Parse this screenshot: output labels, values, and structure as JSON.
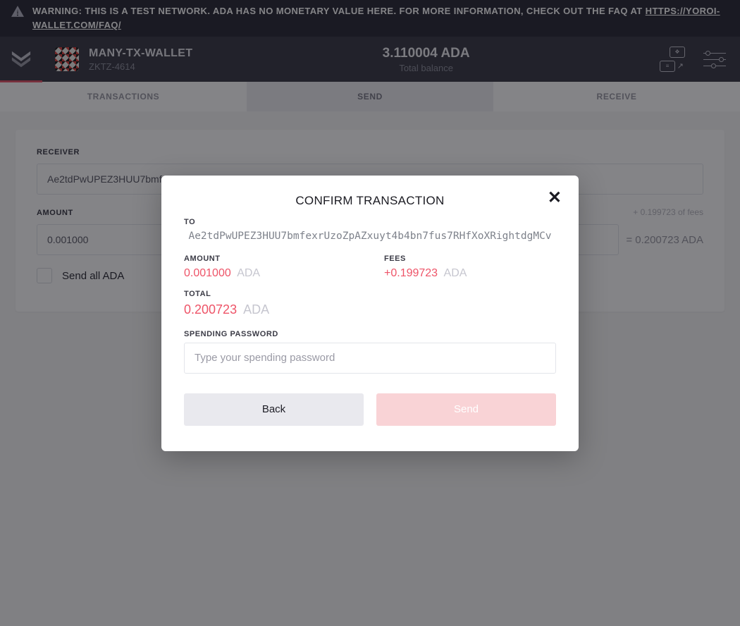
{
  "banner": {
    "text_prefix": "WARNING: THIS IS A TEST NETWORK. ADA HAS NO MONETARY VALUE HERE. FOR MORE INFORMATION, CHECK OUT THE FAQ AT ",
    "link_text": "HTTPS://YOROI-WALLET.COM/FAQ/"
  },
  "header": {
    "wallet_name": "MANY-TX-WALLET",
    "wallet_plate": "ZKTZ-4614",
    "balance_amount": "3.110004 ADA",
    "balance_label": "Total balance"
  },
  "tabs": {
    "transactions": "TRANSACTIONS",
    "send": "SEND",
    "receive": "RECEIVE"
  },
  "send_form": {
    "receiver_label": "RECEIVER",
    "receiver_value": "Ae2tdPwUPEZ3HUU7bmfe",
    "amount_label": "AMOUNT",
    "amount_value": "0.001000",
    "fees_hint": "+ 0.199723 of fees",
    "eq_total": "= 0.200723 ADA",
    "send_all_label": "Send all ADA"
  },
  "modal": {
    "title": "CONFIRM TRANSACTION",
    "to_label": "TO",
    "to_address": "Ae2tdPwUPEZ3HUU7bmfexrUzoZpAZxuyt4b4bn7fus7RHfXoXRightdgMCv",
    "amount_label": "AMOUNT",
    "amount_value": "0.001000",
    "amount_unit": "ADA",
    "fees_label": "FEES",
    "fees_value": "+0.199723",
    "fees_unit": "ADA",
    "total_label": "TOTAL",
    "total_value": "0.200723",
    "total_unit": "ADA",
    "pw_label": "SPENDING PASSWORD",
    "pw_placeholder": "Type your spending password",
    "back_label": "Back",
    "send_label": "Send"
  },
  "colors": {
    "accent": "#ee5468",
    "dark_bg": "#2b2b36"
  }
}
